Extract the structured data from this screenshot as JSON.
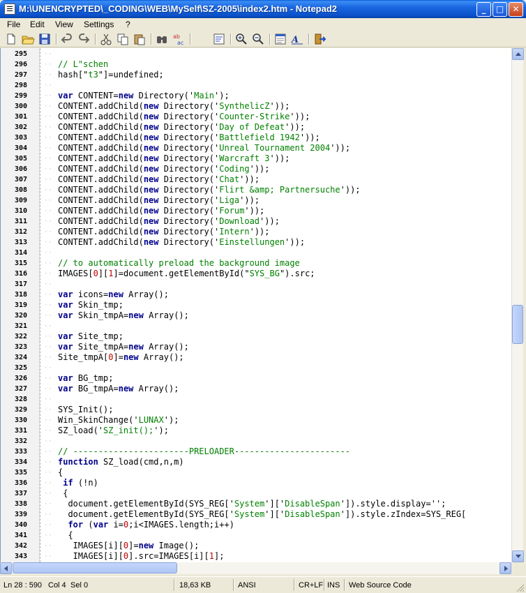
{
  "window": {
    "title": "M:\\UNENCRYPTED\\_CODING\\WEB\\MySelf\\SZ-2005\\index2.htm - Notepad2",
    "min_label": "_",
    "max_label": "□",
    "close_label": "✕"
  },
  "menu": [
    "File",
    "Edit",
    "View",
    "Settings",
    "?"
  ],
  "toolbar_icons": [
    "new-file-icon",
    "open-file-icon",
    "save-icon",
    "undo-icon",
    "redo-icon",
    "cut-icon",
    "copy-icon",
    "paste-icon",
    "find-icon",
    "replace-icon",
    "word-wrap-icon",
    "zoom-in-icon",
    "zoom-out-icon",
    "scheme-icon",
    "font-icon",
    "exit-icon"
  ],
  "lines": [
    {
      "n": "295",
      "t": ""
    },
    {
      "n": "296",
      "t": "// L\"schen"
    },
    {
      "n": "297",
      "t": "hash[\"t3\"]=undefined;"
    },
    {
      "n": "298",
      "t": ""
    },
    {
      "n": "299",
      "t": "var CONTENT=new Directory('Main');"
    },
    {
      "n": "300",
      "t": "CONTENT.addChild(new Directory('SynthelicZ'));"
    },
    {
      "n": "301",
      "t": "CONTENT.addChild(new Directory('Counter-Strike'));"
    },
    {
      "n": "302",
      "t": "CONTENT.addChild(new Directory('Day of Defeat'));"
    },
    {
      "n": "303",
      "t": "CONTENT.addChild(new Directory('Battlefield 1942'));"
    },
    {
      "n": "304",
      "t": "CONTENT.addChild(new Directory('Unreal Tournament 2004'));"
    },
    {
      "n": "305",
      "t": "CONTENT.addChild(new Directory('Warcraft 3'));"
    },
    {
      "n": "306",
      "t": "CONTENT.addChild(new Directory('Coding'));"
    },
    {
      "n": "307",
      "t": "CONTENT.addChild(new Directory('Chat'));"
    },
    {
      "n": "308",
      "t": "CONTENT.addChild(new Directory('Flirt &amp; Partnersuche'));"
    },
    {
      "n": "309",
      "t": "CONTENT.addChild(new Directory('Liga'));"
    },
    {
      "n": "310",
      "t": "CONTENT.addChild(new Directory('Forum'));"
    },
    {
      "n": "311",
      "t": "CONTENT.addChild(new Directory('Download'));"
    },
    {
      "n": "312",
      "t": "CONTENT.addChild(new Directory('Intern'));"
    },
    {
      "n": "313",
      "t": "CONTENT.addChild(new Directory('Einstellungen'));"
    },
    {
      "n": "314",
      "t": ""
    },
    {
      "n": "315",
      "t": "// to automatically preload the background image"
    },
    {
      "n": "316",
      "t": "IMAGES[0][1]=document.getElementById(\"SYS_BG\").src;"
    },
    {
      "n": "317",
      "t": ""
    },
    {
      "n": "318",
      "t": "var icons=new Array();"
    },
    {
      "n": "319",
      "t": "var Skin_tmp;"
    },
    {
      "n": "320",
      "t": "var Skin_tmpA=new Array();"
    },
    {
      "n": "321",
      "t": ""
    },
    {
      "n": "322",
      "t": "var Site_tmp;"
    },
    {
      "n": "323",
      "t": "var Site_tmpA=new Array();"
    },
    {
      "n": "324",
      "t": "Site_tmpA[0]=new Array();"
    },
    {
      "n": "325",
      "t": ""
    },
    {
      "n": "326",
      "t": "var BG_tmp;"
    },
    {
      "n": "327",
      "t": "var BG_tmpA=new Array();"
    },
    {
      "n": "328",
      "t": ""
    },
    {
      "n": "329",
      "t": "SYS_Init();"
    },
    {
      "n": "330",
      "t": "Win_SkinChange('LUNAX');"
    },
    {
      "n": "331",
      "t": "SZ_load('SZ_init();');"
    },
    {
      "n": "332",
      "t": ""
    },
    {
      "n": "333",
      "t": "// -----------------------PRELOADER-----------------------"
    },
    {
      "n": "334",
      "t": "function SZ_load(cmd,n,m)"
    },
    {
      "n": "335",
      "t": "{"
    },
    {
      "n": "336",
      "t": " if (!n)"
    },
    {
      "n": "337",
      "t": " {"
    },
    {
      "n": "338",
      "t": "  document.getElementById(SYS_REG['System']['DisableSpan']).style.display='';"
    },
    {
      "n": "339",
      "t": "  document.getElementById(SYS_REG['System']['DisableSpan']).style.zIndex=SYS_REG["
    },
    {
      "n": "340",
      "t": "  for (var i=0;i<IMAGES.length;i++)"
    },
    {
      "n": "341",
      "t": "  {"
    },
    {
      "n": "342",
      "t": "   IMAGES[i][0]=new Image();"
    },
    {
      "n": "343",
      "t": "   IMAGES[i][0].src=IMAGES[i][1];"
    }
  ],
  "status": {
    "position": "Ln 28 : 590",
    "col": "Col 4",
    "sel": "Sel 0",
    "size": "18,63 KB",
    "encoding": "ANSI",
    "eol": "CR+LF",
    "ins": "INS",
    "scheme": "Web Source Code"
  }
}
